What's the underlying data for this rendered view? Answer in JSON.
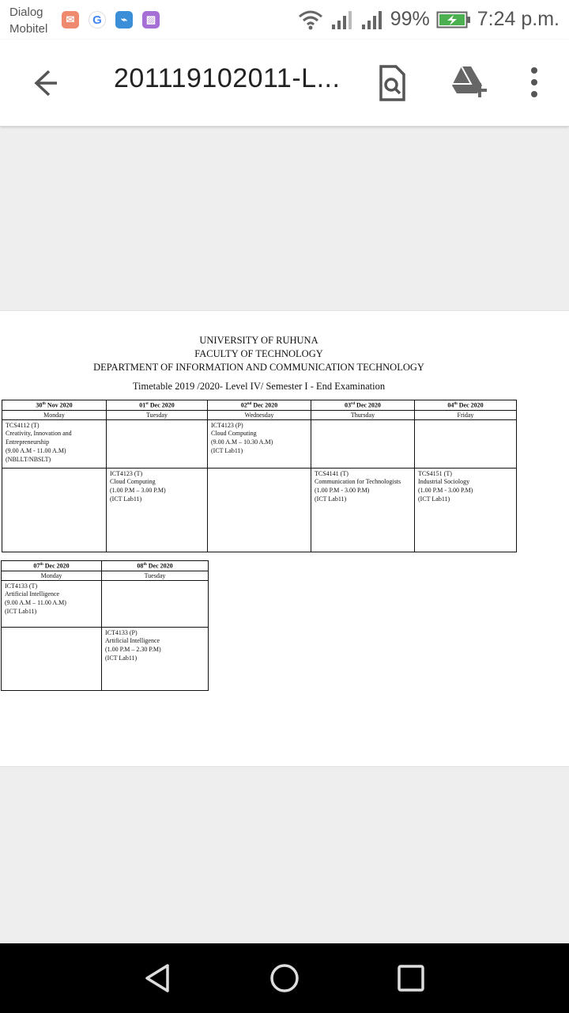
{
  "status_bar": {
    "carrier_line1": "Dialog",
    "carrier_line2": "Mobitel",
    "battery": "99%",
    "time": "7:24 p.m."
  },
  "app_bar": {
    "title": "201119102011-L...",
    "icons": [
      "back-arrow-icon",
      "find-in-page-icon",
      "add-to-drive-icon",
      "more-vert-icon"
    ]
  },
  "document": {
    "line1": "UNIVERSITY OF RUHUNA",
    "line2": "FACULTY OF TECHNOLOGY",
    "line3": "DEPARTMENT OF INFORMATION AND COMMUNICATION TECHNOLOGY",
    "line4": "Timetable 2019 /2020- Level IV/ Semester I - End Examination",
    "week1": {
      "days": [
        {
          "date": "30",
          "sup": "th",
          "rest": " Nov 2020",
          "day": "Monday"
        },
        {
          "date": "01",
          "sup": "st",
          "rest": " Dec 2020",
          "day": "Tuesday"
        },
        {
          "date": "02",
          "sup": "nd",
          "rest": " Dec 2020",
          "day": "Wednesday"
        },
        {
          "date": "03",
          "sup": "rd",
          "rest": " Dec 2020",
          "day": "Thursday"
        },
        {
          "date": "04",
          "sup": "th",
          "rest": " Dec 2020",
          "day": "Friday"
        }
      ],
      "morning": [
        "TCS4112 (T)\nCreativity, Innovation and Entrepreneurship\n(9.00 A.M - 11.00 A.M)\n(NBLLT/NBSLT)",
        "",
        "ICT4123 (P)\nCloud Computing\n(9.00 A.M – 10.30 A.M)\n(ICT Lab11)",
        "",
        ""
      ],
      "afternoon": [
        "",
        "ICT4123 (T)\nCloud Computing\n(1.00 P.M – 3.00 P.M)\n(ICT Lab11)",
        "",
        "TCS4141 (T)\nCommunication for Technologists\n(1.00 P.M - 3.00 P.M)\n(ICT Lab11)",
        "TCS4151 (T)\nIndustrial Sociology\n(1.00 P.M - 3.00 P.M)\n(ICT Lab11)"
      ]
    },
    "week2": {
      "days": [
        {
          "date": "07",
          "sup": "th",
          "rest": "  Dec 2020",
          "day": "Monday"
        },
        {
          "date": "08",
          "sup": "th",
          "rest": " Dec 2020",
          "day": "Tuesday"
        }
      ],
      "morning": [
        "ICT4133 (T)\nArtificial Intelligence\n(9.00 A.M – 11.00 A.M)\n(ICT Lab11)",
        ""
      ],
      "afternoon": [
        "",
        "ICT4133 (P)\nArtificial Intelligence\n(1.00 P.M – 2.30 P.M)\n(ICT Lab11)"
      ]
    }
  },
  "nav_bar": {
    "icons": [
      "nav-back-icon",
      "nav-home-icon",
      "nav-recents-icon"
    ]
  }
}
